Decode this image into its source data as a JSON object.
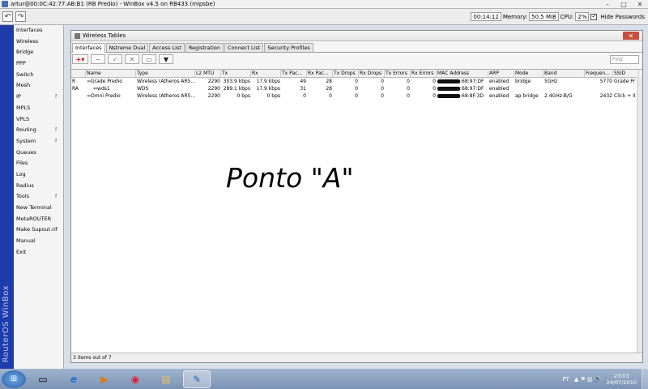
{
  "window": {
    "title": "artur@00:0C:42:77:AB:B1 (RB Predio) - WinBox v4.5 on RB433 (mipsbe)",
    "minimize": "–",
    "maximize": "□",
    "close": "✕"
  },
  "toolbar": {
    "undo": "↶",
    "redo": "↷",
    "uptime": "00:14:12",
    "memory_label": "Memory:",
    "memory_value": "50.5 MiB",
    "cpu_label": "CPU:",
    "cpu_value": "2%",
    "hide_passwords_label": "Hide Passwords",
    "hide_passwords_checked": "✓"
  },
  "brand_strip": "RouterOS WinBox",
  "sidebar": {
    "items": [
      {
        "label": "Interfaces",
        "arrow": ""
      },
      {
        "label": "Wireless",
        "arrow": ""
      },
      {
        "label": "Bridge",
        "arrow": ""
      },
      {
        "label": "PPP",
        "arrow": ""
      },
      {
        "label": "Switch",
        "arrow": ""
      },
      {
        "label": "Mesh",
        "arrow": ""
      },
      {
        "label": "IP",
        "arrow": "↾"
      },
      {
        "label": "MPLS",
        "arrow": ""
      },
      {
        "label": "VPLS",
        "arrow": ""
      },
      {
        "label": "Routing",
        "arrow": "↾"
      },
      {
        "label": "System",
        "arrow": "↾"
      },
      {
        "label": "Queues",
        "arrow": ""
      },
      {
        "label": "Files",
        "arrow": ""
      },
      {
        "label": "Log",
        "arrow": ""
      },
      {
        "label": "Radius",
        "arrow": ""
      },
      {
        "label": "Tools",
        "arrow": "↾"
      },
      {
        "label": "New Terminal",
        "arrow": ""
      },
      {
        "label": "MetaROUTER",
        "arrow": ""
      },
      {
        "label": "Make Supout.rif",
        "arrow": ""
      },
      {
        "label": "Manual",
        "arrow": ""
      },
      {
        "label": "Exit",
        "arrow": ""
      }
    ]
  },
  "wireless_window": {
    "title": "Wireless Tables",
    "close": "✕",
    "tabs": [
      "Interfaces",
      "Nstreme Dual",
      "Access List",
      "Registration",
      "Connect List",
      "Security Profiles"
    ],
    "toolbar_buttons": {
      "add": "+▾",
      "remove": "−",
      "enable": "✓",
      "disable": "✕",
      "comment": "▭",
      "filter": "▼"
    },
    "find_placeholder": "Find",
    "columns": [
      "",
      "Name",
      "Type",
      "L2 MTU",
      "Tx",
      "Rx",
      "Tx Pac...",
      "Rx Pac...",
      "Tx Drops",
      "Rx Drops",
      "Tx Errors",
      "Rx Errors",
      "MAC Address",
      "ARP",
      "Mode",
      "Band",
      "Frequen...",
      "SSID"
    ],
    "rows": [
      {
        "flag": "R",
        "name": "Grade Predio",
        "type": "Wireless (Atheros AR5...",
        "l2mtu": "2290",
        "tx": "303.9 kbps",
        "rx": "17.9 kbps",
        "txp": "49",
        "rxp": "28",
        "txd": "0",
        "rxd": "0",
        "txe": "0",
        "rxe": "0",
        "mac": ":68:97:DF",
        "arp": "enabled",
        "mode": "bridge",
        "band": "5GHz",
        "freq": "5770",
        "ssid": "Grade Pr"
      },
      {
        "flag": "RA",
        "name": "wds1",
        "type": "WDS",
        "l2mtu": "2290",
        "tx": "289.1 kbps",
        "rx": "17.9 kbps",
        "txp": "31",
        "rxp": "28",
        "txd": "0",
        "rxd": "0",
        "txe": "0",
        "rxe": "0",
        "mac": ":68:97:DF",
        "arp": "enabled",
        "mode": "",
        "band": "",
        "freq": "",
        "ssid": ""
      },
      {
        "flag": "",
        "name": "Omni Predio",
        "type": "Wireless (Atheros AR5...",
        "l2mtu": "2290",
        "tx": "0 bps",
        "rx": "0 bps",
        "txp": "0",
        "rxp": "0",
        "txd": "0",
        "rxd": "0",
        "txe": "0",
        "rxe": "0",
        "mac": ":68:8F:3D",
        "arp": "enabled",
        "mode": "ap bridge",
        "band": "2.4GHz-B/G",
        "freq": "2432",
        "ssid": "Click + II"
      }
    ],
    "footer": "3 items out of 7"
  },
  "overlay_text": "Ponto \"A\"",
  "taskbar": {
    "start": "⊞",
    "apps": [
      {
        "name": "explorer-window",
        "glyph": "▭"
      },
      {
        "name": "internet-explorer",
        "glyph": "e"
      },
      {
        "name": "media-player",
        "glyph": "▶"
      },
      {
        "name": "chrome",
        "glyph": "◉"
      },
      {
        "name": "folder",
        "glyph": "▤"
      },
      {
        "name": "winbox",
        "glyph": "✎"
      }
    ],
    "language": "PT",
    "tray_icons": "▲ ⚑ ▥ 🔊",
    "time": "23:03",
    "date": "24/07/2010"
  }
}
